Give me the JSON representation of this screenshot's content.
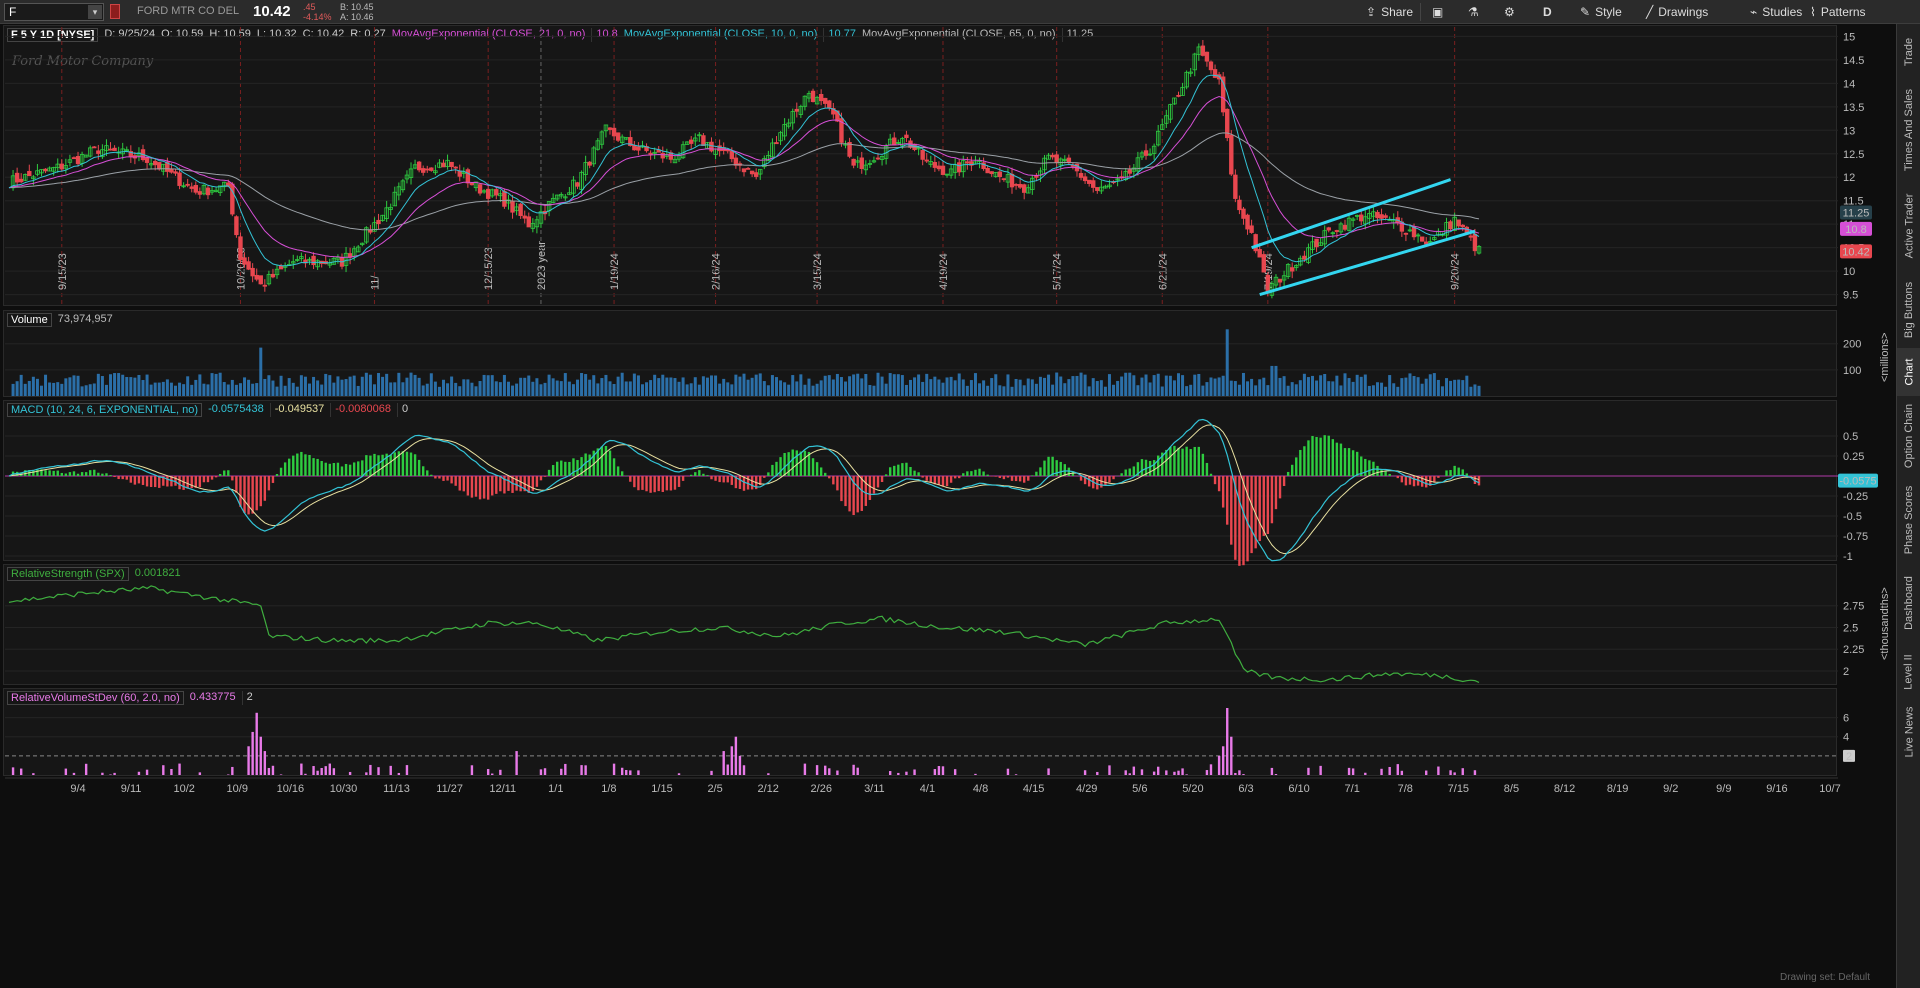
{
  "topbar": {
    "symbol": "F",
    "company": "FORD MTR CO DEL",
    "last": "10.42",
    "change": ".45",
    "change_pct": "-4.14%",
    "bid": "B: 10.45",
    "ask": "A: 10.46",
    "share_label": "Share",
    "period_label": "D",
    "style_label": "Style",
    "drawings_label": "Drawings",
    "studies_label": "Studies",
    "patterns_label": "Patterns"
  },
  "price_panel": {
    "title": "F 5 Y 1D [NYSE]",
    "d": "D: 9/25/24",
    "o": "O: 10.59",
    "h": "H: 10.59",
    "l": "L: 10.32",
    "c": "C: 10.42",
    "r": "R: 0.27",
    "ema21_label": "MovAvgExponential (CLOSE, 21, 0, no)",
    "ema21_val": "10.8",
    "ema10_label": "MovAvgExponential (CLOSE, 10, 0, no)",
    "ema10_val": "10.77",
    "ema65_label": "MovAvgExponential (CLOSE, 65, 0, no)",
    "ema65_val": "11.25",
    "watermark": "Ford Motor Company",
    "yticks": [
      "15",
      "14.5",
      "14",
      "13.5",
      "13",
      "12.5",
      "12",
      "11.5",
      "11",
      "10.5",
      "10",
      "9.5"
    ],
    "badge_ema65": "11.25",
    "badge_ema21": "10.8",
    "badge_last": "10.42",
    "vert_labels": [
      "9/15/23",
      "10/20/23",
      "11/",
      "12/15/23",
      "2023 year",
      "1/19/24",
      "2/16/24",
      "3/15/24",
      "4/19/24",
      "5/17/24",
      "6/21/24",
      "7/19/24",
      "9/20/24"
    ]
  },
  "volume_panel": {
    "label": "Volume",
    "value": "73,974,957",
    "yticks": [
      "200",
      "100"
    ],
    "unit": "<millions>"
  },
  "macd_panel": {
    "label": "MACD (10, 24, 6, EXPONENTIAL, no)",
    "v1": "-0.0575438",
    "v2": "-0.049537",
    "v3": "-0.0080068",
    "v4": "0",
    "yticks": [
      "0.5",
      "0.25",
      "-0.25",
      "-0.5",
      "-0.75",
      "-1"
    ],
    "badge": "-0.0575"
  },
  "rs_panel": {
    "label": "RelativeStrength (SPX)",
    "value": "0.001821",
    "yticks": [
      "2.75",
      "2.5",
      "2.25",
      "2"
    ],
    "unit": "<thousandths>"
  },
  "rvsd_panel": {
    "label": "RelativeVolumeStDev (60, 2.0, no)",
    "value": "0.433775",
    "value2": "2",
    "yticks": [
      "6",
      "4",
      "2"
    ],
    "badge": "2"
  },
  "xaxis": [
    "9/4",
    "9/11",
    "10/2",
    "10/9",
    "10/16",
    "10/30",
    "11/13",
    "11/27",
    "12/11",
    "1/1",
    "1/8",
    "1/15",
    "2/5",
    "2/12",
    "2/26",
    "3/11",
    "4/1",
    "4/8",
    "4/15",
    "4/29",
    "5/6",
    "5/20",
    "6/3",
    "6/10",
    "7/1",
    "7/8",
    "7/15",
    "8/5",
    "8/12",
    "8/19",
    "9/2",
    "9/9",
    "9/16",
    "10/7"
  ],
  "side_tabs": [
    "Trade",
    "Times And Sales",
    "Active Trader",
    "Big Buttons",
    "Chart",
    "Option Chain",
    "Phase Scores",
    "Dashboard",
    "Level II",
    "Live News"
  ],
  "footer": "Drawing set: Default",
  "colors": {
    "up": "#2ecc40",
    "down": "#e8474f",
    "ema10": "#33c3d6",
    "ema21": "#d64fd6",
    "ema65": "#9aa0a6",
    "volume": "#2b6fa8",
    "trendline": "#33d6f0",
    "rs": "#3fae3f",
    "rvsd": "#e87ae8"
  }
}
